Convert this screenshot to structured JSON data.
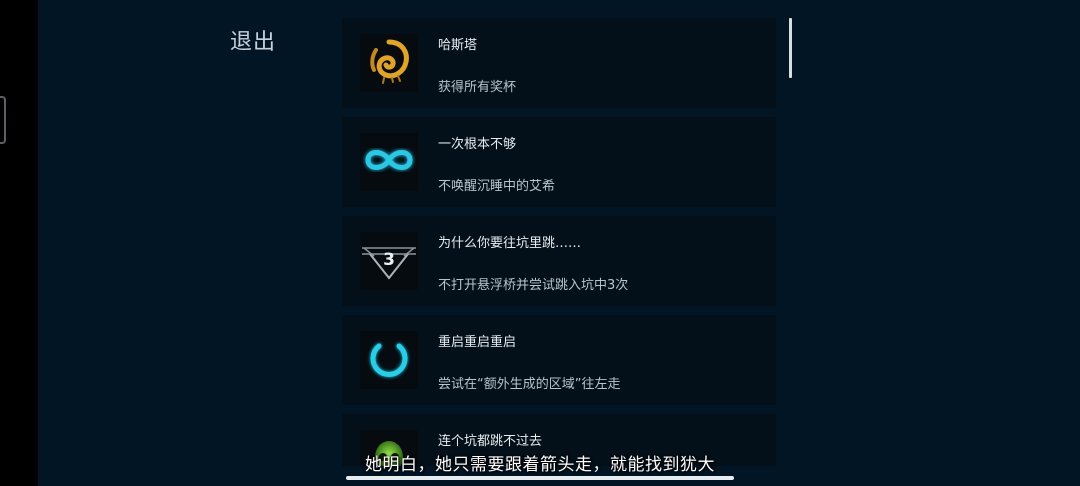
{
  "menu": {
    "exit_label": "退出"
  },
  "achievements": [
    {
      "title": "哈斯塔",
      "description": "获得所有奖杯",
      "icon": "gold-swirl-icon"
    },
    {
      "title": "一次根本不够",
      "description": "不唤醒沉睡中的艾希",
      "icon": "infinity-icon"
    },
    {
      "title": "为什么你要往坑里跳……",
      "description": "不打开悬浮桥并尝试跳入坑中3次",
      "icon": "pit-three-icon",
      "icon_text": "3"
    },
    {
      "title": "重启重启重启",
      "description": "尝试在“额外生成的区域”往左走",
      "icon": "power-icon"
    },
    {
      "title": "连个坑都跳不过去",
      "description": "",
      "icon": "green-skull-icon"
    }
  ],
  "subtitle": "她明白，她只需要跟着箭头走，就能找到犹大",
  "colors": {
    "background": "#021525",
    "card": "#031019",
    "accent_cyan": "#1fc8e0",
    "gold": "#e0a020"
  }
}
